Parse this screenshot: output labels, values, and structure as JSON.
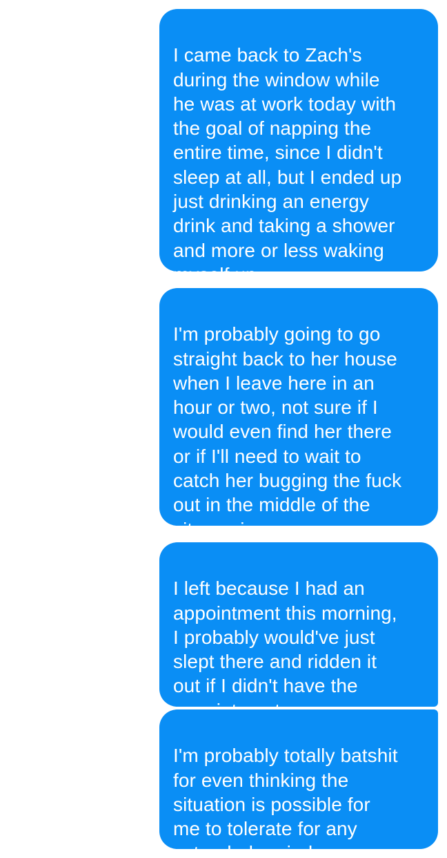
{
  "theme": {
    "bubble_color": "#0a8ef5",
    "text_color": "#ffffff",
    "background": "#ffffff"
  },
  "messages": [
    {
      "text": "I came back to Zach's\nduring the window while\nhe was at work today with\nthe goal of napping the\nentire time, since I didn't\nsleep at all, but I ended up\njust drinking an energy\ndrink and taking a shower\nand more or less waking\nmyself up"
    },
    {
      "text": "I'm probably going to go\nstraight back to her house\nwhen I leave here in an\nhour or two, not sure if I\nwould even find her there\nor if I'll need to wait to\ncatch her bugging the fuck\nout in the middle of the\ncity again"
    },
    {
      "text": "I left because I had an\nappointment this morning,\nI probably would've just\nslept there and ridden it\nout if I didn't have the\nappointment"
    },
    {
      "text": "I'm probably totally batshit\nfor even thinking the\nsituation is possible for\nme to tolerate for any\nextended period"
    }
  ]
}
